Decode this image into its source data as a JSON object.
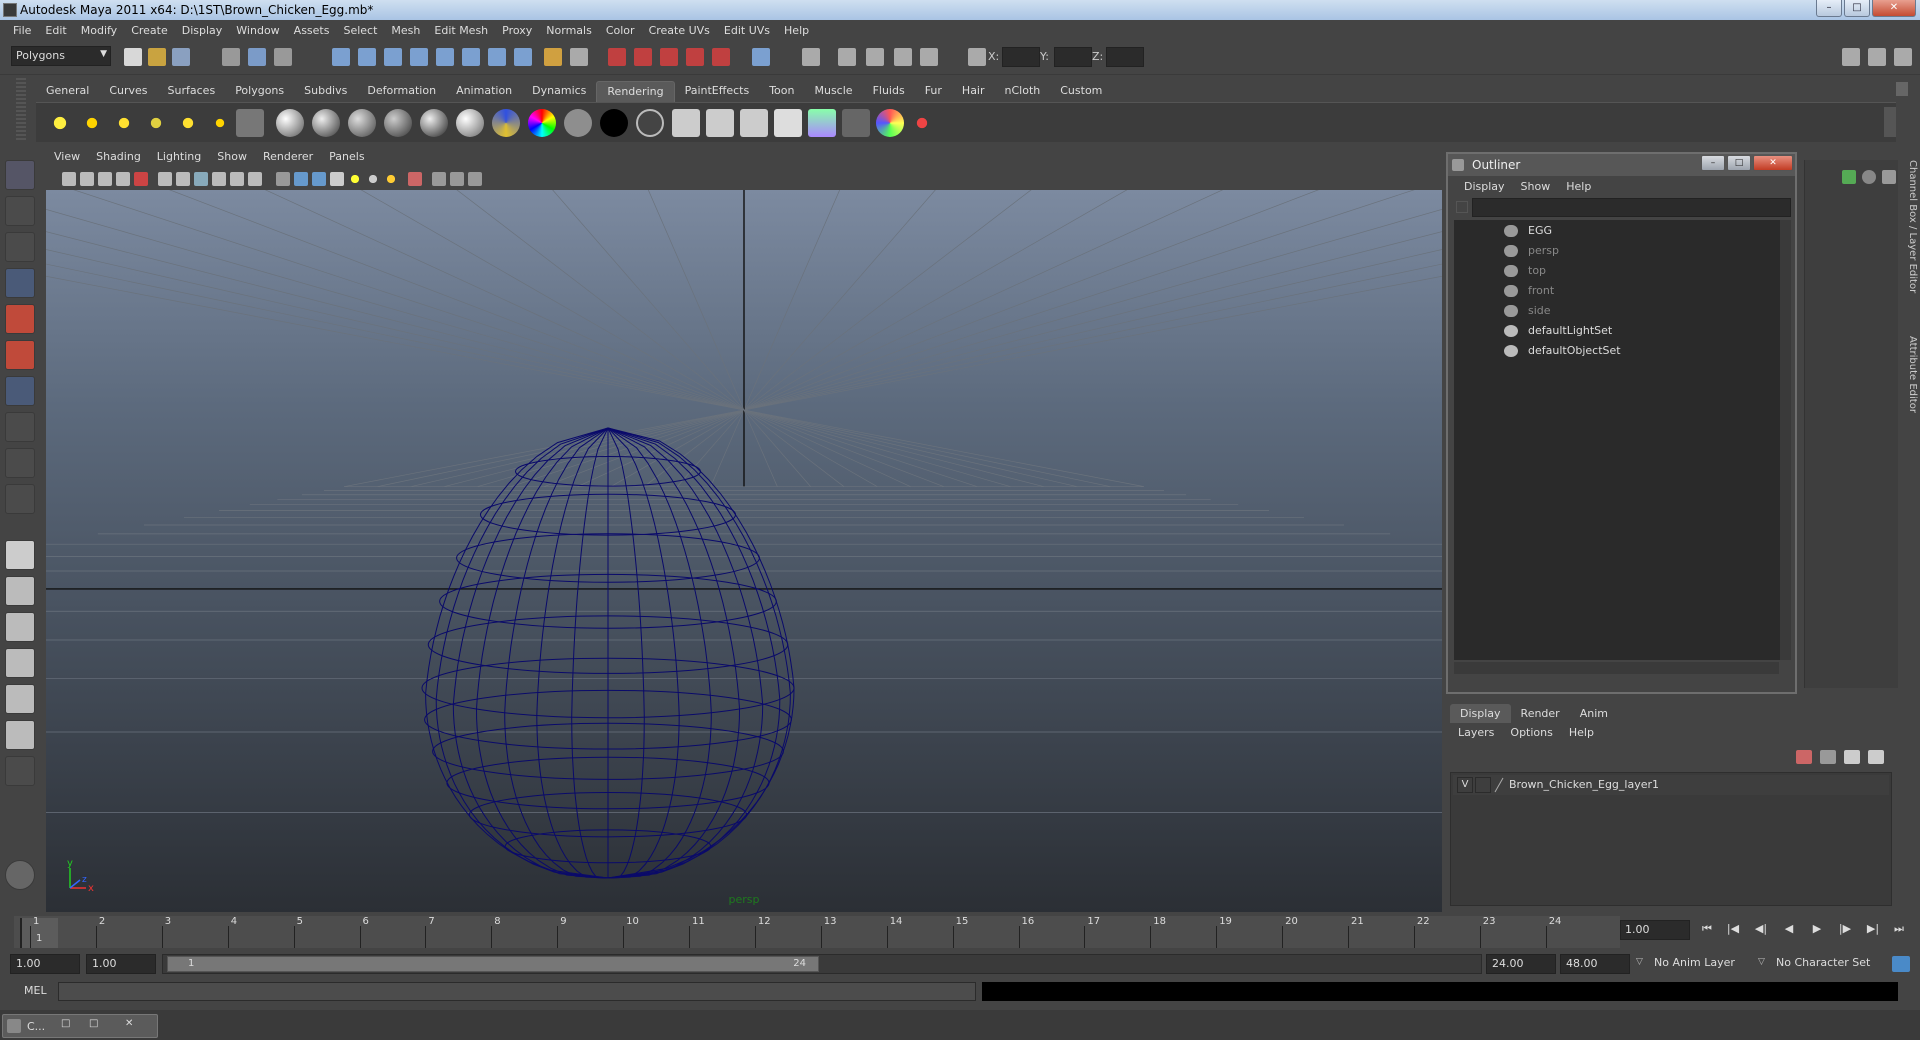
{
  "window": {
    "title": "Autodesk Maya 2011 x64: D:\\1ST\\Brown_Chicken_Egg.mb*",
    "min_label": "–",
    "max_label": "□",
    "close_label": "✕"
  },
  "menubar": [
    "File",
    "Edit",
    "Modify",
    "Create",
    "Display",
    "Window",
    "Assets",
    "Select",
    "Mesh",
    "Edit Mesh",
    "Proxy",
    "Normals",
    "Color",
    "Create UVs",
    "Edit UVs",
    "Help"
  ],
  "toolbar": {
    "mode": "Polygons",
    "x_label": "X:",
    "y_label": "Y:",
    "z_label": "Z:"
  },
  "shelf_tabs": [
    "General",
    "Curves",
    "Surfaces",
    "Polygons",
    "Subdivs",
    "Deformation",
    "Animation",
    "Dynamics",
    "Rendering",
    "PaintEffects",
    "Toon",
    "Muscle",
    "Fluids",
    "Fur",
    "Hair",
    "nCloth",
    "Custom"
  ],
  "shelf_active": "Rendering",
  "panel_menu": [
    "View",
    "Shading",
    "Lighting",
    "Show",
    "Renderer",
    "Panels"
  ],
  "viewport": {
    "camera_label": "persp",
    "axis_y": "y",
    "axis_x": "x",
    "axis_z": "z",
    "wire_color": "#0a0a6a"
  },
  "outliner": {
    "title": "Outliner",
    "menu": [
      "Display",
      "Show",
      "Help"
    ],
    "items": [
      {
        "name": "EGG",
        "dim": false
      },
      {
        "name": "persp",
        "dim": true
      },
      {
        "name": "top",
        "dim": true
      },
      {
        "name": "front",
        "dim": true
      },
      {
        "name": "side",
        "dim": true
      },
      {
        "name": "defaultLightSet",
        "dim": false
      },
      {
        "name": "defaultObjectSet",
        "dim": false
      }
    ]
  },
  "side_tabs": {
    "channel_box": "Channel Box / Layer Editor",
    "attribute_editor": "Attribute Editor"
  },
  "layer_editor": {
    "tabs": [
      "Display",
      "Render",
      "Anim"
    ],
    "menu": [
      "Layers",
      "Options",
      "Help"
    ],
    "layer": {
      "visible": "V",
      "name": "Brown_Chicken_Egg_layer1"
    }
  },
  "timeline": {
    "frames": [
      "1",
      "2",
      "3",
      "4",
      "5",
      "6",
      "7",
      "8",
      "9",
      "10",
      "11",
      "12",
      "13",
      "14",
      "15",
      "16",
      "17",
      "18",
      "19",
      "20",
      "21",
      "22",
      "23",
      "24"
    ],
    "current_frame_marker": "1",
    "current_time": "1.00"
  },
  "range": {
    "start": "1.00",
    "playback_start": "1.00",
    "slider_start": "1",
    "slider_end": "24",
    "playback_end": "24.00",
    "end": "48.00",
    "anim_layer": "No Anim Layer",
    "character_set": "No Character Set"
  },
  "command_line": {
    "label": "MEL"
  },
  "taskbar": {
    "item": "C..."
  }
}
